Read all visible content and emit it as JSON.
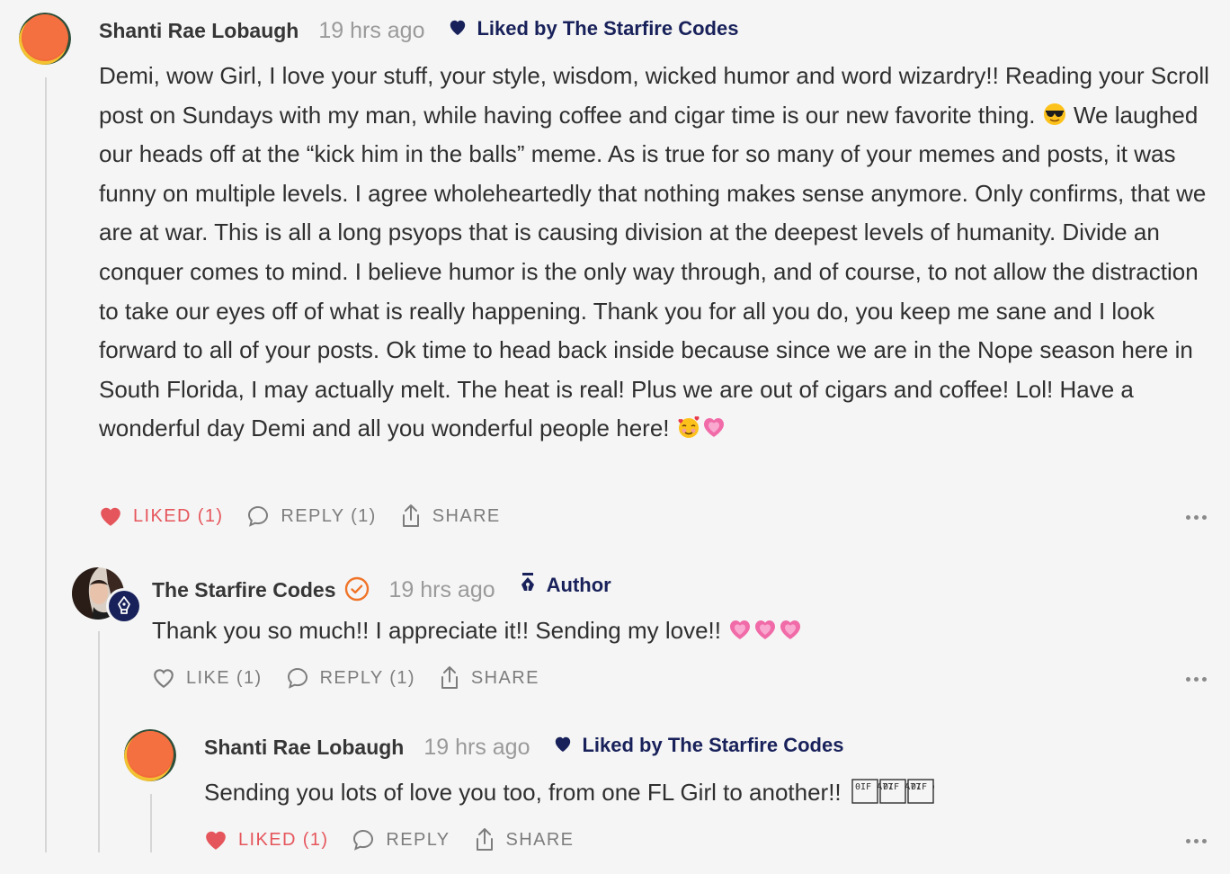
{
  "colors": {
    "accent_navy": "#18215a",
    "liked_red": "#e5565c",
    "verified_orange": "#f07428",
    "text_muted": "#7d7d7d"
  },
  "comments": [
    {
      "author": "Shanti Rae Lobaugh",
      "time": "19 hrs ago",
      "liked_by": "Liked by The Starfire Codes",
      "body_text": "Demi, wow Girl, I love your stuff, your style, wisdom, wicked humor and word wizardry!! Reading your Scroll post on Sundays with my man, while having coffee and cigar time is our new favorite thing.",
      "body_text_2": "We laughed our heads off at the “kick him in the balls” meme. As is true for so many of your memes and posts, it was funny on multiple levels. I agree wholeheartedly that nothing makes sense anymore. Only confirms, that we are at war. This is all a long psyops that is causing division at the deepest levels of humanity. Divide an conquer comes to mind. I believe humor is the only way through, and of course, to not allow the distraction to take our eyes off of what is really happening. Thank you for all you do, you keep me sane and I look forward to all of your posts. Ok time to head back inside because since we are in the Nope season here in South Florida, I may actually melt. The heat is real! Plus we are out of cigars and coffee! Lol! Have a wonderful day Demi and all you wonderful people here!",
      "emojis": [
        "smiling-face-with-sunglasses",
        "smiling-face-with-hearts",
        "growing-heart"
      ],
      "actions": {
        "like": "LIKED (1)",
        "reply": "REPLY (1)",
        "share": "SHARE"
      }
    },
    {
      "author": "The Starfire Codes",
      "time": "19 hrs ago",
      "author_badge": "Author",
      "body_text": "Thank you so much!! I appreciate it!! Sending my love!!",
      "emojis": [
        "growing-heart",
        "growing-heart",
        "growing-heart"
      ],
      "actions": {
        "like": "LIKE (1)",
        "reply": "REPLY (1)",
        "share": "SHARE"
      }
    },
    {
      "author": "Shanti Rae Lobaugh",
      "time": "19 hrs ago",
      "liked_by": "Liked by The Starfire Codes",
      "body_text": "Sending you lots of love you too, from one FL Girl to another!!",
      "unrendered_glyphs": [
        "0IF A77",
        "0IF A77",
        "0IF A77"
      ],
      "actions": {
        "like": "LIKED (1)",
        "reply": "REPLY",
        "share": "SHARE"
      }
    }
  ]
}
